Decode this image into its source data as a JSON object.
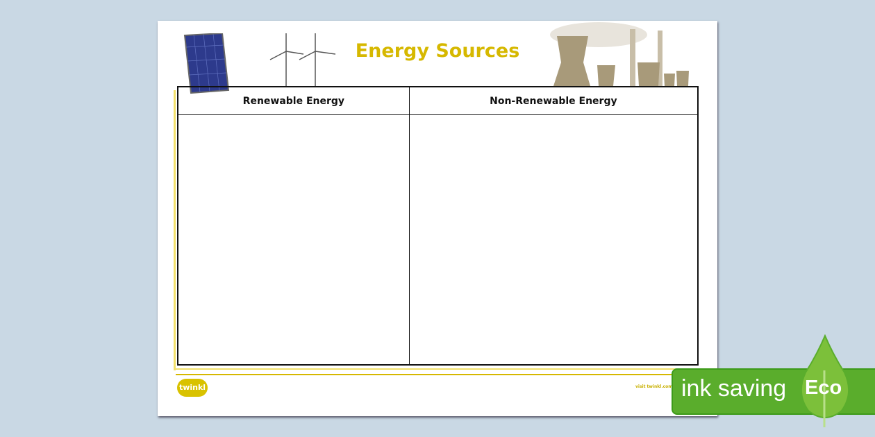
{
  "worksheet": {
    "title": "Energy Sources",
    "columns": [
      "Renewable Energy",
      "Non-Renewable Energy"
    ]
  },
  "footer": {
    "logo": "twinkl",
    "visit": "visit twinkl.com"
  },
  "badge": {
    "text": "ink saving",
    "eco": "Eco",
    "color": "#5aad2c"
  },
  "colors": {
    "title": "#d6b800",
    "background": "#c9d8e4"
  }
}
